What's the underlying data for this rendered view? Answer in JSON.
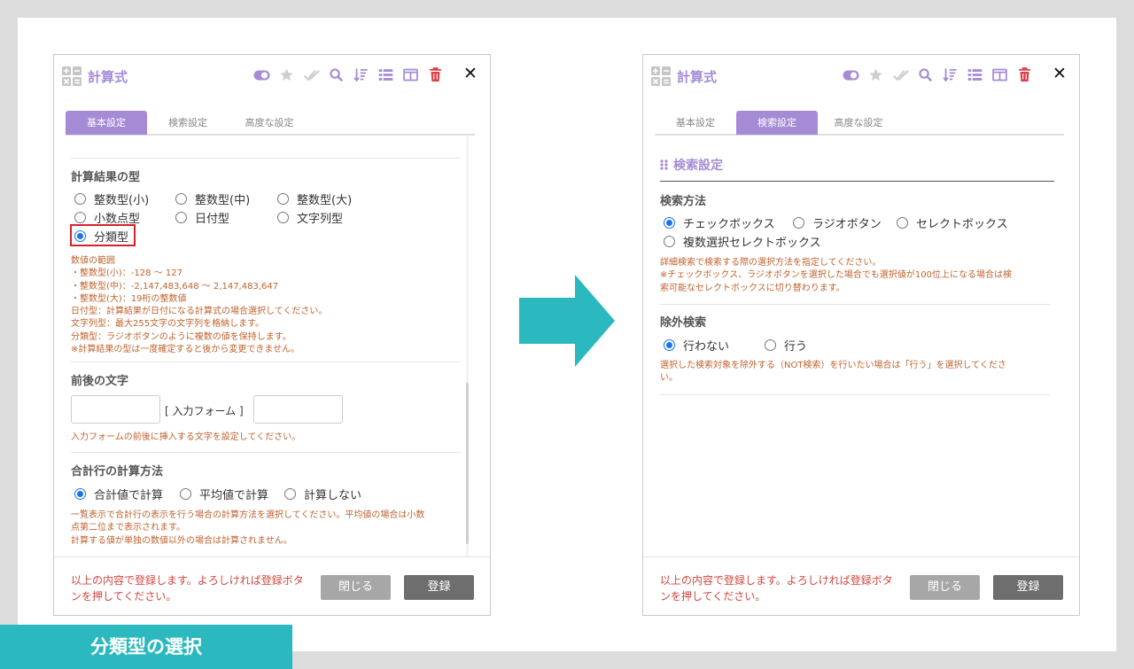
{
  "caption": "分類型の選択",
  "colors": {
    "accent": "#a58bd6",
    "note": "#c0632f",
    "danger": "#d2232a",
    "arrow": "#2bb8bf"
  },
  "toolbar_icons": [
    "toggle-icon",
    "star-icon",
    "double-check-icon",
    "search-icon",
    "sort-icon",
    "list-icon",
    "columns-icon",
    "trash-icon"
  ],
  "left": {
    "title": "計算式",
    "close": "✕",
    "tabs": [
      "基本設定",
      "検索設定",
      "高度な設定"
    ],
    "active_tab": 0,
    "result_type": {
      "title": "計算結果の型",
      "options": [
        "整数型(小)",
        "整数型(中)",
        "整数型(大)",
        "小数点型",
        "日付型",
        "文字列型",
        "分類型"
      ],
      "selected": "分類型",
      "notes": [
        "数値の範囲",
        "・整数型(小)：-128 〜 127",
        "・整数型(中)：-2,147,483,648 〜 2,147,483,647",
        "・整数型(大)：19桁の整数値",
        "日付型：計算結果が日付になる計算式の場合選択してください。",
        "文字列型：最大255文字の文字列を格納します。",
        "分類型：ラジオボタンのように複数の値を保持します。",
        "※計算結果の型は一度確定すると後から変更できません。"
      ]
    },
    "affix": {
      "title": "前後の文字",
      "prefix_value": "",
      "suffix_value": "",
      "middle_label": "[ 入力フォーム ]",
      "note": "入力フォームの前後に挿入する文字を設定してください。"
    },
    "total": {
      "title": "合計行の計算方法",
      "options": [
        "合計値で計算",
        "平均値で計算",
        "計算しない"
      ],
      "selected": "合計値で計算",
      "notes": [
        "一覧表示で合計行の表示を行う場合の計算方法を選択してください。平均値の場合は小数",
        "点第二位まで表示されます。",
        "計算する値が単独の数値以外の場合は計算されません。"
      ]
    },
    "footer": {
      "message_lines": [
        "以上の内容で登録します。よろしければ登録ボタ",
        "ンを押してください。"
      ],
      "close_label": "閉じる",
      "save_label": "登録"
    }
  },
  "right": {
    "title": "計算式",
    "close": "✕",
    "tabs": [
      "基本設定",
      "検索設定",
      "高度な設定"
    ],
    "active_tab": 1,
    "panel_title": "検索設定",
    "search_method": {
      "title": "検索方法",
      "options": [
        "チェックボックス",
        "ラジオボタン",
        "セレクトボックス",
        "複数選択セレクトボックス"
      ],
      "selected": "チェックボックス",
      "notes": [
        "詳細検索で検索する際の選択方法を指定してください。",
        "※チェックボックス、ラジオボタンを選択した場合でも選択値が100位上になる場合は検",
        "索可能なセレクトボックスに切り替わります。"
      ]
    },
    "exclude": {
      "title": "除外検索",
      "options": [
        "行わない",
        "行う"
      ],
      "selected": "行わない",
      "notes": [
        "選択した検索対象を除外する（NOT検索）を行いたい場合は「行う」を選択してくださ",
        "い。"
      ]
    },
    "footer": {
      "message_lines": [
        "以上の内容で登録します。よろしければ登録ボタ",
        "ンを押してください。"
      ],
      "close_label": "閉じる",
      "save_label": "登録"
    }
  }
}
